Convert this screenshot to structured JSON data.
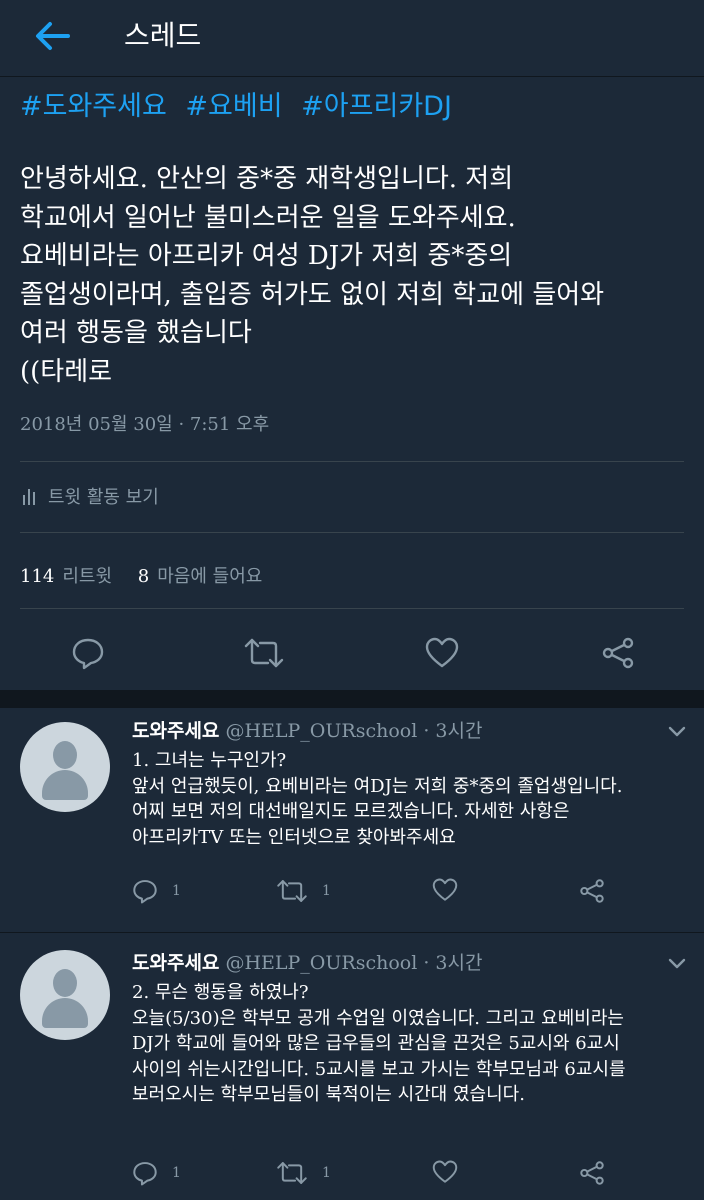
{
  "header": {
    "title": "스레드",
    "back_icon": "arrow-left-icon"
  },
  "tweet": {
    "hashtags": [
      "#도와주세요",
      "#요베비",
      "#아프리카DJ"
    ],
    "body": "안녕하세요. 안산의 중*중 재학생입니다. 저희\n학교에서 일어난 불미스러운 일을 도와주세요.\n요베비라는 아프리카 여성 DJ가 저희 중*중의\n졸업생이라며, 출입증 허가도 없이 저희 학교에 들어와\n여러 행동을 했습니다\n((타레로",
    "timestamp": "2018년 05월 30일 · 7:51 오후",
    "activity_label": "트윗 활동 보기",
    "retweet_count": "114",
    "retweet_label": "리트윗",
    "like_count": "8",
    "like_label": "마음에 들어요"
  },
  "replies": [
    {
      "name": "도와주세요",
      "handle": "@HELP_OURschool",
      "time": "· 3시간",
      "text": "1. 그녀는 누구인가?\n앞서 언급했듯이, 요베비라는 여DJ는 저희 중*중의 졸업생입니다.\n어찌 보면 저의 대선배일지도 모르겠습니다. 자세한 사항은\n아프리카TV 또는 인터넷으로 찾아봐주세요",
      "reply_count": "1",
      "retweet_count": "1"
    },
    {
      "name": "도와주세요",
      "handle": "@HELP_OURschool",
      "time": "· 3시간",
      "text": "2. 무슨 행동을 하였나?\n오늘(5/30)은 학부모 공개 수업일 이였습니다. 그리고 요베비라는\nDJ가 학교에 들어와 많은 급우들의 관심을 끈것은 5교시와 6교시\n사이의 쉬는시간입니다. 5교시를 보고 가시는 학부모님과 6교시를\n보러오시는 학부모님들이 북적이는 시간대 였습니다.",
      "reply_count": "1",
      "retweet_count": "1"
    }
  ],
  "colors": {
    "background": "#1c2938",
    "accent": "#1da1f2",
    "secondary_text": "#8899a6",
    "separator": "#10171e"
  }
}
